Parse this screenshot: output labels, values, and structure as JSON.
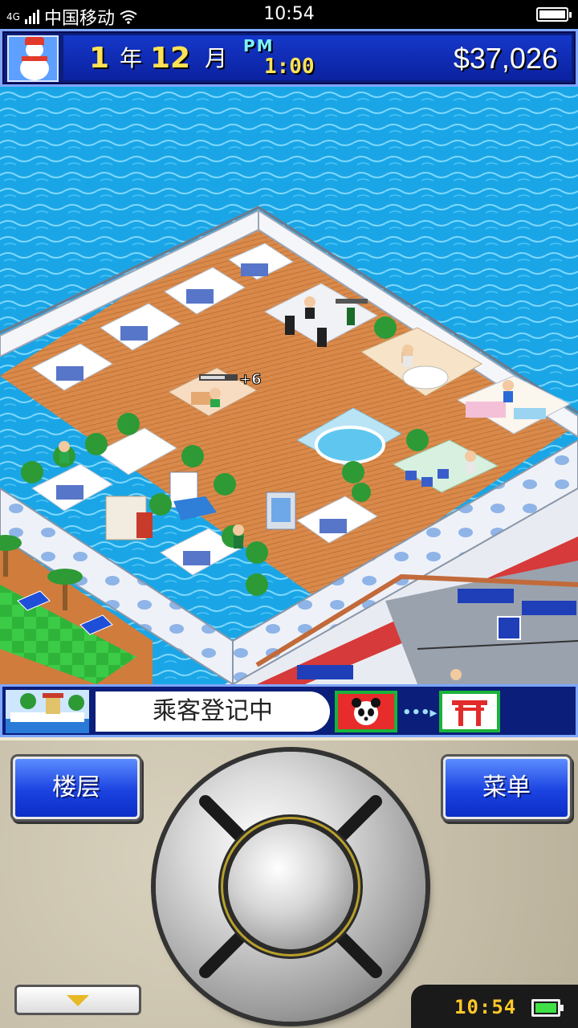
{
  "status_bar": {
    "network": "4G",
    "carrier": "中国移动",
    "time": "10:54",
    "icons": [
      "signal-icon",
      "wifi-icon",
      "battery-icon"
    ]
  },
  "hud": {
    "year": "1",
    "year_unit": "年",
    "month": "12",
    "month_unit": "月",
    "ampm": "PM",
    "clock": "1:00",
    "money": "$37,026",
    "avatar_icon": "snowman-icon"
  },
  "game": {
    "float_bonus": "+6"
  },
  "ticker": {
    "text": "乘客登记中",
    "icons": [
      "cruise-ship-icon",
      "panda-icon",
      "torii-gate-icon"
    ]
  },
  "controls": {
    "floor_label": "楼层",
    "menu_label": "菜单",
    "device_clock": "10:54"
  },
  "colors": {
    "hud_blue": "#1537c9",
    "money_white": "#ffffff",
    "date_yellow": "#ffe255",
    "sea": "#1aa6e6",
    "deck_wood": "#d98a4b",
    "button_blue": "#1b43e0"
  }
}
